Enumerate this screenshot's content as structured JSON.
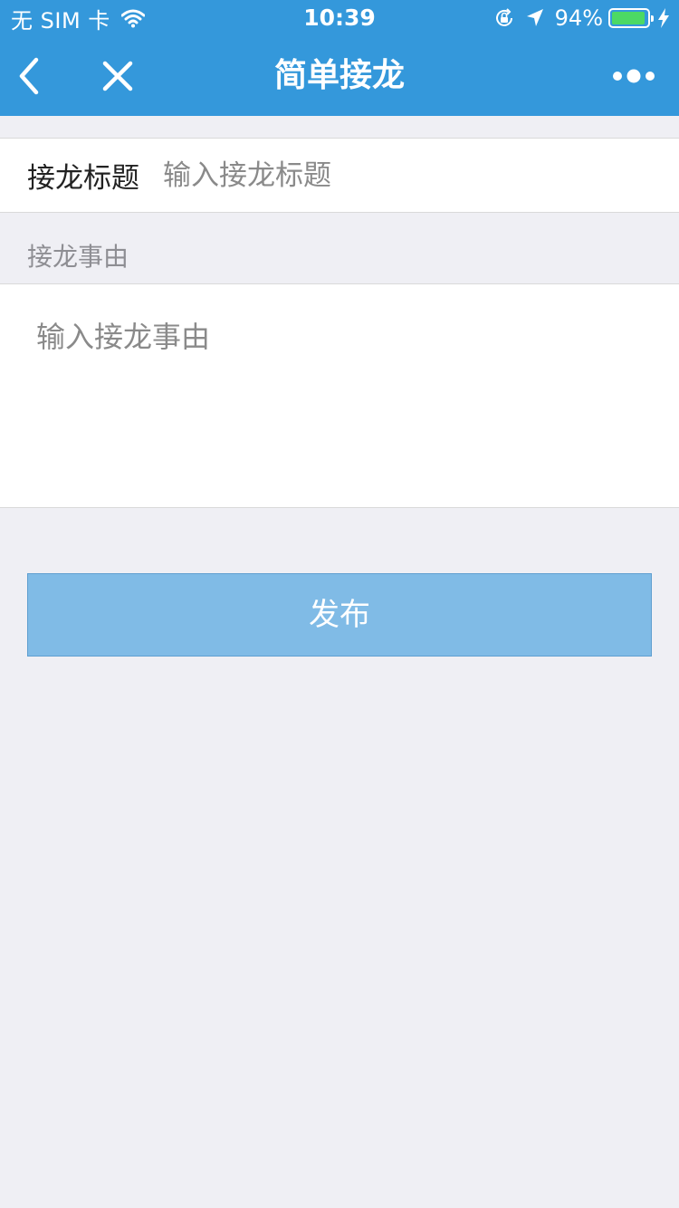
{
  "status_bar": {
    "carrier": "无 SIM 卡",
    "time": "10:39",
    "battery_percent_text": "94%",
    "battery_level": 0.94,
    "icons": [
      "wifi-icon",
      "rotation-lock-icon",
      "location-arrow-icon",
      "battery-icon",
      "charging-bolt-icon"
    ]
  },
  "nav": {
    "title": "简单接龙",
    "icons": [
      "back-chevron-icon",
      "close-icon",
      "more-dots-icon"
    ]
  },
  "form": {
    "title_label": "接龙标题",
    "title_placeholder": "输入接龙标题",
    "title_value": "",
    "reason_label": "接龙事由",
    "reason_placeholder": "输入接龙事由",
    "reason_value": ""
  },
  "publish_button": {
    "label": "发布"
  },
  "colors": {
    "nav_background": "#3498db",
    "page_background": "#efeff4",
    "button_background": "#80bbe6",
    "battery_fill": "#4cd964"
  }
}
